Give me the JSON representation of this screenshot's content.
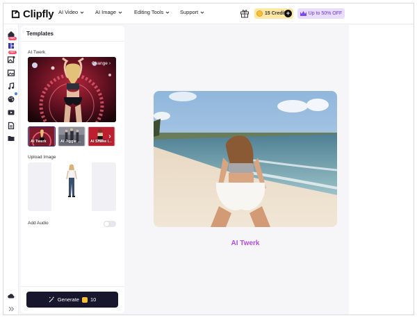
{
  "brand": {
    "name": "Clipfly"
  },
  "nav": {
    "items": [
      {
        "label": "AI Video"
      },
      {
        "label": "AI Image"
      },
      {
        "label": "Editing Tools"
      },
      {
        "label": "Support"
      }
    ],
    "credits_label": "15 Credits",
    "promo_label": "Up to 50% OFF"
  },
  "rail": {
    "items": [
      "home-icon",
      "templates-icon",
      "image-edit-icon",
      "picture-icon",
      "music-icon",
      "palette-icon",
      "video-icon",
      "document-icon",
      "folder-icon",
      "cloud-icon",
      "expand-icon"
    ],
    "badges": [
      "HOT",
      "HOT"
    ]
  },
  "panel": {
    "title": "Templates",
    "template_section": "AI Twerk",
    "change_label": "Change",
    "thumbnails": [
      {
        "label": "AI Twerk"
      },
      {
        "label": "AI Jiggle ..."
      },
      {
        "label": "AI Shake I..."
      }
    ],
    "upload_label": "Upload Image",
    "audio_label": "Add Audio",
    "audio_enabled": false,
    "generate_label": "Generate",
    "generate_cost": "10"
  },
  "canvas": {
    "result_title": "AI Twerk"
  },
  "colors": {
    "accent": "#b44be6",
    "generate_bg": "#17162d",
    "credits_bg": "#fde7a3",
    "promo_bg": "#e8dcff"
  }
}
